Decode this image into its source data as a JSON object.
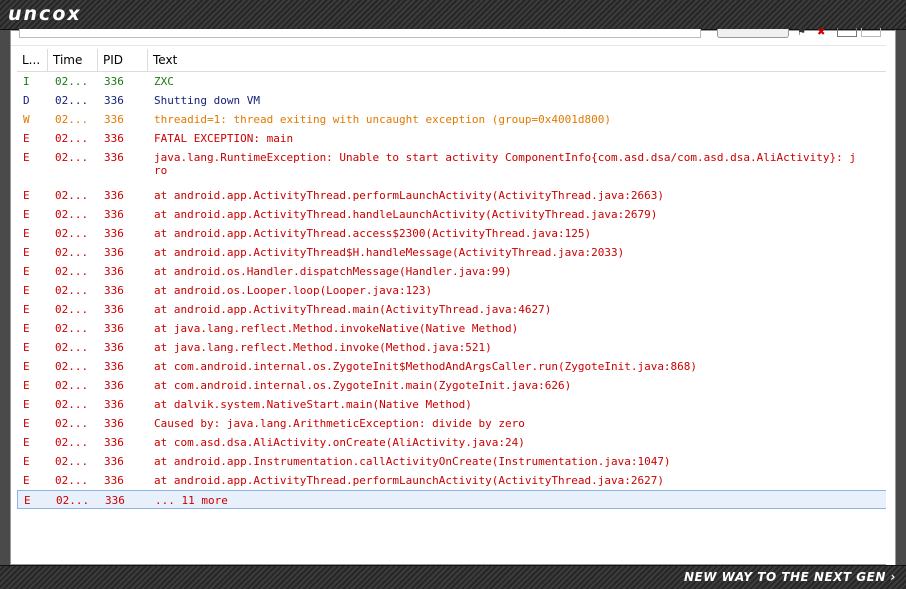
{
  "brand": {
    "logo": "uncox",
    "tagline": "NEW WAY TO THE NEXT GEN ›"
  },
  "columns": {
    "level": "L...",
    "time": "Time",
    "pid": "PID",
    "text": "Text"
  },
  "rows": [
    {
      "level": "I",
      "time": "02...",
      "pid": "336",
      "text": "ZXC"
    },
    {
      "level": "D",
      "time": "02...",
      "pid": "336",
      "text": "Shutting down VM"
    },
    {
      "level": "W",
      "time": "02...",
      "pid": "336",
      "text": "threadid=1: thread exiting with uncaught exception (group=0x4001d800)"
    },
    {
      "level": "E",
      "time": "02...",
      "pid": "336",
      "text": "FATAL EXCEPTION: main"
    },
    {
      "level": "E",
      "time": "02...",
      "pid": "336",
      "text": "java.lang.RuntimeException: Unable to start activity ComponentInfo{com.asd.dsa/com.asd.dsa.AliActivity}: j\nro"
    },
    {
      "level": "E",
      "time": "02...",
      "pid": "336",
      "text": "at android.app.ActivityThread.performLaunchActivity(ActivityThread.java:2663)"
    },
    {
      "level": "E",
      "time": "02...",
      "pid": "336",
      "text": "at android.app.ActivityThread.handleLaunchActivity(ActivityThread.java:2679)"
    },
    {
      "level": "E",
      "time": "02...",
      "pid": "336",
      "text": "at android.app.ActivityThread.access$2300(ActivityThread.java:125)"
    },
    {
      "level": "E",
      "time": "02...",
      "pid": "336",
      "text": "at android.app.ActivityThread$H.handleMessage(ActivityThread.java:2033)"
    },
    {
      "level": "E",
      "time": "02...",
      "pid": "336",
      "text": "at android.os.Handler.dispatchMessage(Handler.java:99)"
    },
    {
      "level": "E",
      "time": "02...",
      "pid": "336",
      "text": "at android.os.Looper.loop(Looper.java:123)"
    },
    {
      "level": "E",
      "time": "02...",
      "pid": "336",
      "text": "at android.app.ActivityThread.main(ActivityThread.java:4627)"
    },
    {
      "level": "E",
      "time": "02...",
      "pid": "336",
      "text": "at java.lang.reflect.Method.invokeNative(Native Method)"
    },
    {
      "level": "E",
      "time": "02...",
      "pid": "336",
      "text": "at java.lang.reflect.Method.invoke(Method.java:521)"
    },
    {
      "level": "E",
      "time": "02...",
      "pid": "336",
      "text": "at com.android.internal.os.ZygoteInit$MethodAndArgsCaller.run(ZygoteInit.java:868)"
    },
    {
      "level": "E",
      "time": "02...",
      "pid": "336",
      "text": "at com.android.internal.os.ZygoteInit.main(ZygoteInit.java:626)"
    },
    {
      "level": "E",
      "time": "02...",
      "pid": "336",
      "text": "at dalvik.system.NativeStart.main(Native Method)"
    },
    {
      "level": "E",
      "time": "02...",
      "pid": "336",
      "text": "Caused by: java.lang.ArithmeticException: divide by zero"
    },
    {
      "level": "E",
      "time": "02...",
      "pid": "336",
      "text": "at com.asd.dsa.AliActivity.onCreate(AliActivity.java:24)"
    },
    {
      "level": "E",
      "time": "02...",
      "pid": "336",
      "text": "at android.app.Instrumentation.callActivityOnCreate(Instrumentation.java:1047)"
    },
    {
      "level": "E",
      "time": "02...",
      "pid": "336",
      "text": "at android.app.ActivityThread.performLaunchActivity(ActivityThread.java:2627)"
    },
    {
      "level": "E",
      "time": "02...",
      "pid": "336",
      "text": "... 11 more",
      "selected": true
    }
  ],
  "colors": {
    "info": "#1a7a12",
    "debug": "#17217a",
    "warn": "#e07a00",
    "error": "#cc0000",
    "selection": "#e7f0fb"
  },
  "icons": {
    "toolbar": [
      "filter-icon",
      "clear-icon",
      "view-icon",
      "view-icon"
    ]
  }
}
